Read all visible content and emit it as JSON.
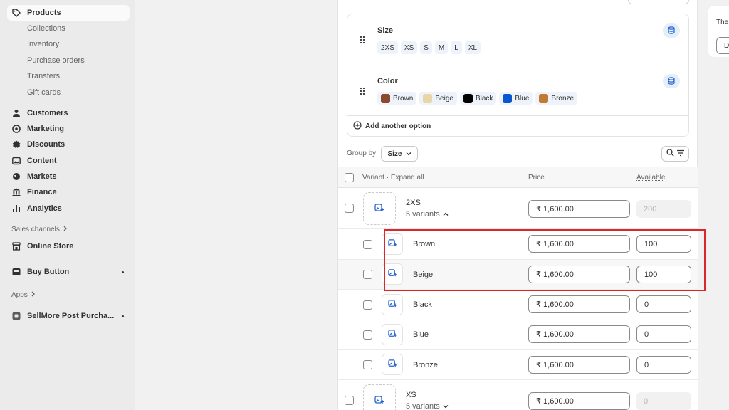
{
  "sidebar": {
    "products": "Products",
    "sub": [
      "Collections",
      "Inventory",
      "Purchase orders",
      "Transfers",
      "Gift cards"
    ],
    "items": [
      "Customers",
      "Marketing",
      "Discounts",
      "Content",
      "Markets",
      "Finance",
      "Analytics"
    ],
    "sales_channels": "Sales channels",
    "online_store": "Online Store",
    "buy_button": "Buy Button",
    "apps": "Apps",
    "sellmore": "SellMore Post Purcha..."
  },
  "options": {
    "size": {
      "title": "Size",
      "values": [
        "2XS",
        "XS",
        "S",
        "M",
        "L",
        "XL"
      ]
    },
    "color": {
      "title": "Color",
      "values": [
        {
          "name": "Brown",
          "color": "#8b4a2b"
        },
        {
          "name": "Beige",
          "color": "#e8d5a8"
        },
        {
          "name": "Black",
          "color": "#000000"
        },
        {
          "name": "Blue",
          "color": "#0a55d0"
        },
        {
          "name": "Bronze",
          "color": "#c17a33"
        }
      ]
    },
    "add_another": "Add another option"
  },
  "group_by": {
    "label": "Group by",
    "value": "Size"
  },
  "table": {
    "col_variant": "Variant · Expand all",
    "col_price": "Price",
    "col_available": "Available"
  },
  "groups": [
    {
      "name": "2XS",
      "sub": "5 variants",
      "price": "₹ 1,600.00",
      "available": "200"
    },
    {
      "name": "XS",
      "sub": "5 variants",
      "price": "₹ 1,600.00",
      "available": "0"
    }
  ],
  "variants": [
    {
      "name": "Brown",
      "price": "₹ 1,600.00",
      "available": "100"
    },
    {
      "name": "Beige",
      "price": "₹ 1,600.00",
      "available": "100"
    },
    {
      "name": "Black",
      "price": "₹ 1,600.00",
      "available": "0"
    },
    {
      "name": "Blue",
      "price": "₹ 1,600.00",
      "available": "0"
    },
    {
      "name": "Bronze",
      "price": "₹ 1,600.00",
      "available": "0"
    }
  ],
  "right_panel": {
    "text": "The",
    "box": "D"
  }
}
